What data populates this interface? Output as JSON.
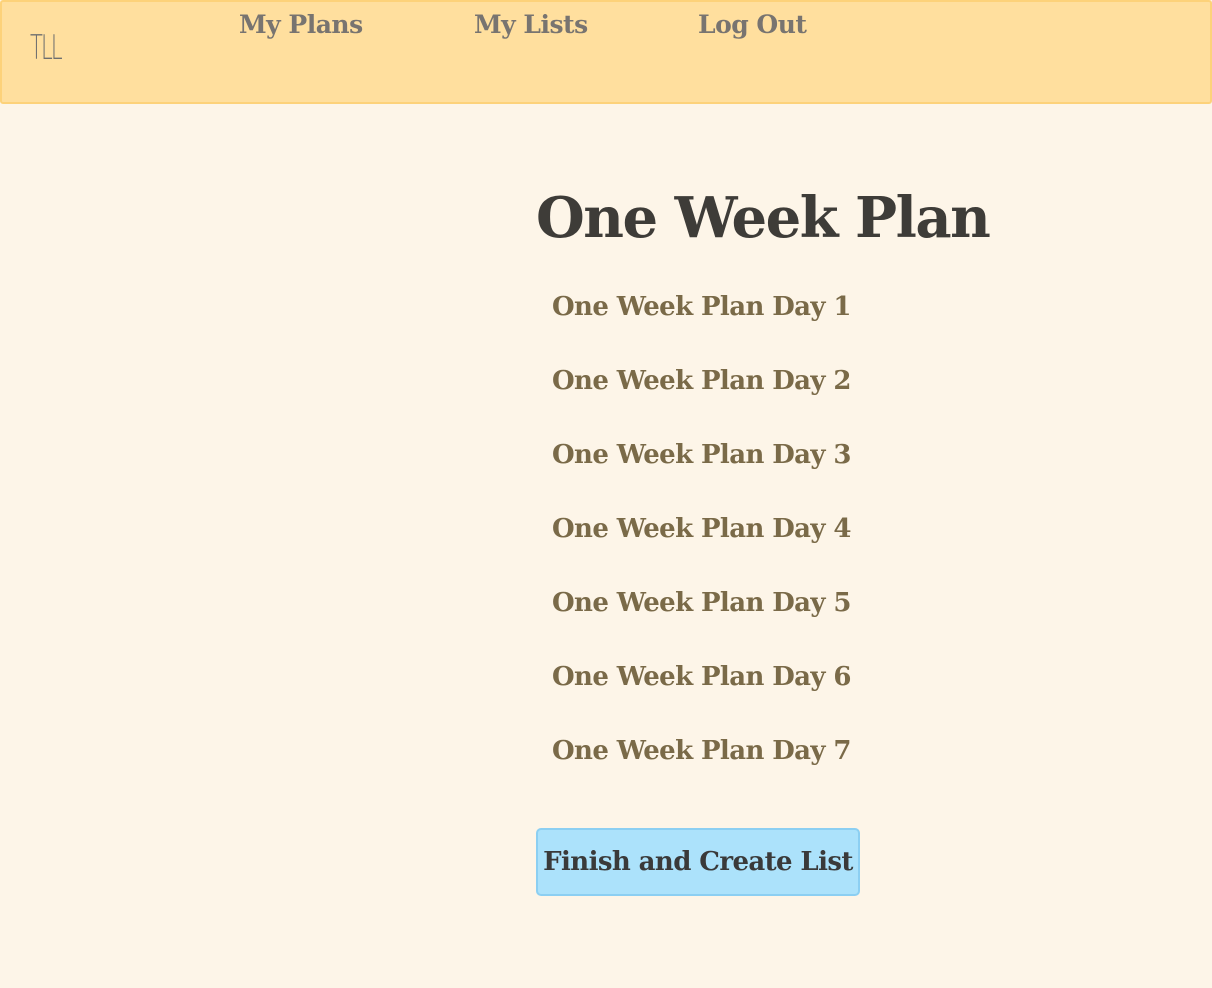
{
  "nav": {
    "logo": "TLL",
    "links": [
      {
        "label": "My Plans"
      },
      {
        "label": "My Lists"
      },
      {
        "label": "Log Out"
      }
    ]
  },
  "plan": {
    "title": "One Week Plan",
    "days": [
      {
        "label": "One Week Plan Day 1"
      },
      {
        "label": "One Week Plan Day 2"
      },
      {
        "label": "One Week Plan Day 3"
      },
      {
        "label": "One Week Plan Day 4"
      },
      {
        "label": "One Week Plan Day 5"
      },
      {
        "label": "One Week Plan Day 6"
      },
      {
        "label": "One Week Plan Day 7"
      }
    ],
    "finish_button_label": "Finish and Create List"
  },
  "colors": {
    "navbar_bg": "#ffdf9e",
    "page_bg": "#fdf5e8",
    "button_bg": "#ace2fb",
    "day_text": "#7a6a48",
    "title_text": "#3e3c38"
  }
}
